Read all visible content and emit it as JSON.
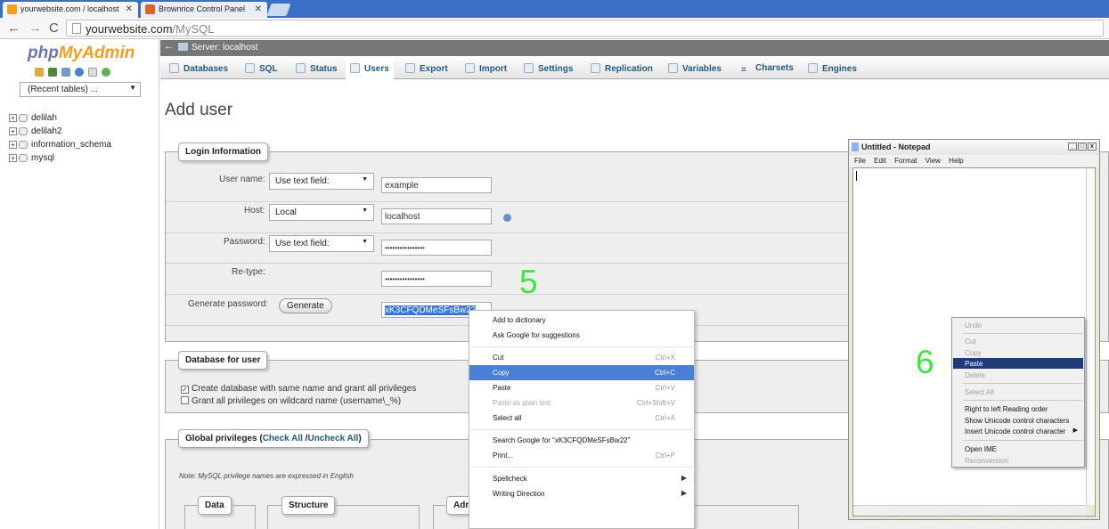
{
  "browser": {
    "tabs": [
      {
        "label": "yourwebsite.com / localhost",
        "active": true
      },
      {
        "label": "Brownrice Control Panel",
        "active": false
      }
    ],
    "url_host": "yourwebsite.com",
    "url_path": "/MySQL"
  },
  "sidebar": {
    "logo_part1": "php",
    "logo_part2": "MyAdmin",
    "recent_tables": "(Recent tables) ...",
    "databases": [
      "delilah",
      "delilah2",
      "information_schema",
      "mysql"
    ]
  },
  "serverbar": {
    "label": "Server: localhost"
  },
  "menu": [
    {
      "label": "Databases",
      "active": false
    },
    {
      "label": "SQL",
      "active": false
    },
    {
      "label": "Status",
      "active": false
    },
    {
      "label": "Users",
      "active": true
    },
    {
      "label": "Export",
      "active": false
    },
    {
      "label": "Import",
      "active": false
    },
    {
      "label": "Settings",
      "active": false
    },
    {
      "label": "Replication",
      "active": false
    },
    {
      "label": "Variables",
      "active": false
    },
    {
      "label": "Charsets",
      "active": false
    },
    {
      "label": "Engines",
      "active": false
    }
  ],
  "page": {
    "title": "Add user",
    "login": {
      "legend": "Login Information",
      "username_label": "User name:",
      "username_select": "Use text field:",
      "username_value": "example",
      "host_label": "Host:",
      "host_select": "Local",
      "host_value": "localhost",
      "password_label": "Password:",
      "password_select": "Use text field:",
      "password_value": "••••••••••••••••",
      "retype_label": "Re-type:",
      "retype_value": "••••••••••••••••",
      "generate_label": "Generate password:",
      "generate_button": "Generate",
      "generated_value": "xK3CFQDMeSFsBw22"
    },
    "database": {
      "legend": "Database for user",
      "option1": "Create database with same name and grant all privileges",
      "option1_checked": true,
      "option2": "Grant all privileges on wildcard name (username\\_%)",
      "option2_checked": false
    },
    "global": {
      "legend_prefix": "Global privileges (",
      "check_all": "Check All",
      "separator": " /",
      "uncheck_all": "Uncheck All",
      "legend_suffix": ")",
      "note": "Note: MySQL privilege names are expressed in English",
      "groups": [
        "Data",
        "Structure",
        "Adr"
      ]
    }
  },
  "annotations": {
    "step5": "5",
    "step6": "6",
    "color": "#3ce63c"
  },
  "context_menu": {
    "items": [
      {
        "label": "Add to dictionary",
        "shortcut": "",
        "disabled": false,
        "highlight": false
      },
      {
        "label": "Ask Google for suggestions",
        "shortcut": "",
        "disabled": false,
        "highlight": false
      },
      {
        "label": "Cut",
        "shortcut": "Ctrl+X",
        "disabled": false,
        "highlight": false
      },
      {
        "label": "Copy",
        "shortcut": "Ctrl+C",
        "disabled": false,
        "highlight": true
      },
      {
        "label": "Paste",
        "shortcut": "Ctrl+V",
        "disabled": false,
        "highlight": false
      },
      {
        "label": "Paste as plain text",
        "shortcut": "Ctrl+Shift+V",
        "disabled": true,
        "highlight": false
      },
      {
        "label": "Select all",
        "shortcut": "Ctrl+A",
        "disabled": false,
        "highlight": false
      },
      {
        "label": "Search Google for “xK3CFQDMeSFsBw22”",
        "shortcut": "",
        "disabled": false,
        "highlight": false
      },
      {
        "label": "Print...",
        "shortcut": "Ctrl+P",
        "disabled": false,
        "highlight": false
      },
      {
        "label": "Spellcheck",
        "shortcut": "",
        "disabled": false,
        "highlight": false,
        "submenu": true
      },
      {
        "label": "Writing Direction",
        "shortcut": "",
        "disabled": false,
        "highlight": false,
        "submenu": true
      }
    ]
  },
  "notepad": {
    "title": "Untitled - Notepad",
    "menu": [
      "File",
      "Edit",
      "Format",
      "View",
      "Help"
    ],
    "context_menu": [
      {
        "label": "Undo",
        "disabled": true
      },
      {
        "label": "Cut",
        "disabled": true
      },
      {
        "label": "Copy",
        "disabled": true
      },
      {
        "label": "Paste",
        "disabled": false,
        "highlight": true
      },
      {
        "label": "Delete",
        "disabled": true
      },
      {
        "label": "Select All",
        "disabled": true
      },
      {
        "label": "Right to left Reading order",
        "disabled": false
      },
      {
        "label": "Show Unicode control characters",
        "disabled": false
      },
      {
        "label": "Insert Unicode control character",
        "disabled": false,
        "submenu": true
      },
      {
        "label": "Open IME",
        "disabled": false
      },
      {
        "label": "Reconversion",
        "disabled": true
      }
    ]
  },
  "icons": {
    "back": "arrow-left-icon",
    "forward": "arrow-right-icon",
    "reload": "reload-icon",
    "page": "page-icon"
  }
}
